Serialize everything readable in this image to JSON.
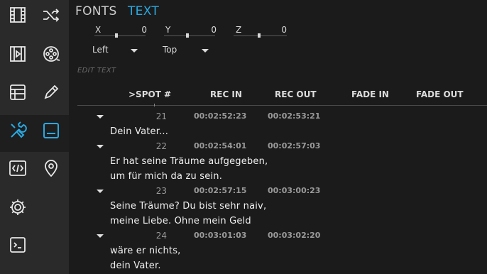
{
  "sidebar": {
    "icons": [
      "film-strip-icon",
      "shuffle-icon",
      "video-file-icon",
      "film-reel-icon",
      "grid-list-icon",
      "pencil-icon",
      "tools-icon",
      "subtitle-panel-icon",
      "code-icon",
      "location-pin-icon",
      "settings-gear-icon",
      "terminal-icon"
    ],
    "active": "tools-icon",
    "accent": "#29a9e1"
  },
  "tabs": {
    "fonts": "FONTS",
    "text": "TEXT"
  },
  "position": {
    "x_label": "X",
    "x_value": "0",
    "y_label": "Y",
    "y_value": "0",
    "z_label": "Z",
    "z_value": "0"
  },
  "align": {
    "horizontal": "Left",
    "vertical": "Top"
  },
  "edit_text_label": "EDIT TEXT",
  "table": {
    "headers": {
      "spot": ">SPOT #",
      "rec_in": "REC IN",
      "rec_out": "REC OUT",
      "fade_in": "FADE IN",
      "fade_out": "FADE OUT"
    },
    "rows": [
      {
        "spot": "21",
        "rec_in": "00:02:52:23",
        "rec_out": "00:02:53:21",
        "line1": "Dein Vater...",
        "line2": ""
      },
      {
        "spot": "22",
        "rec_in": "00:02:54:01",
        "rec_out": "00:02:57:03",
        "line1": "Er hat seine Träume aufgegeben,",
        "line2": "um für mich da zu sein."
      },
      {
        "spot": "23",
        "rec_in": "00:02:57:15",
        "rec_out": "00:03:00:23",
        "line1": "Seine Träume? Du bist sehr naiv,",
        "line2": "meine Liebe. Ohne mein Geld"
      },
      {
        "spot": "24",
        "rec_in": "00:03:01:03",
        "rec_out": "00:03:02:20",
        "line1": "wäre er nichts,",
        "line2": "dein Vater."
      }
    ]
  }
}
